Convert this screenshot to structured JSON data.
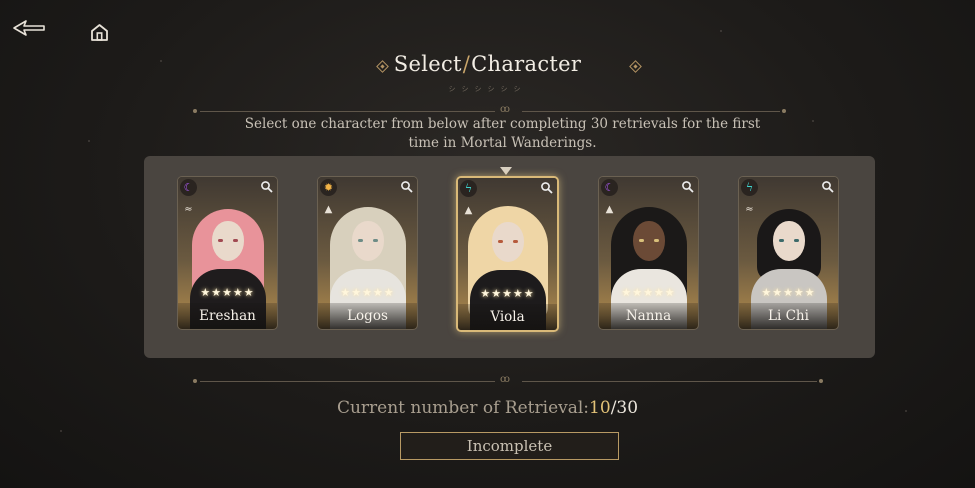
{
  "header": {
    "title_left": "Select",
    "title_sep": "/",
    "title_right": "Character",
    "subtitle_glyphs": "シシシシシシ",
    "back_icon": "back-arrow-icon",
    "home_icon": "home-icon"
  },
  "description": "Select one character from below after completing 30 retrievals for the first time in Mortal Wanderings.",
  "characters": [
    {
      "name": "Ereshan",
      "stars": "★★★★★",
      "element": "moon-icon",
      "element_color": "#b25cff",
      "role": "wing-icon",
      "selected": false
    },
    {
      "name": "Logos",
      "stars": "★★★★★",
      "element": "sun-icon",
      "element_color": "#f2b347",
      "role": "pyramid-eye-icon",
      "selected": false
    },
    {
      "name": "Viola",
      "stars": "★★★★★",
      "element": "lightning-icon",
      "element_color": "#3fd6d0",
      "role": "pyramid-eye-icon",
      "selected": true
    },
    {
      "name": "Nanna",
      "stars": "★★★★★",
      "element": "moon-icon",
      "element_color": "#b25cff",
      "role": "pyramid-eye-icon",
      "selected": false
    },
    {
      "name": "Li Chi",
      "stars": "★★★★★",
      "element": "lightning-icon",
      "element_color": "#3fd6d0",
      "role": "wing-icon",
      "selected": false
    }
  ],
  "progress": {
    "label": "Current number of Retrieval:",
    "current": "10",
    "separator": "/",
    "total": "30"
  },
  "status_button": "Incomplete",
  "colors": {
    "accent_gold": "#d9b978",
    "progress_current": "#e2c278"
  }
}
